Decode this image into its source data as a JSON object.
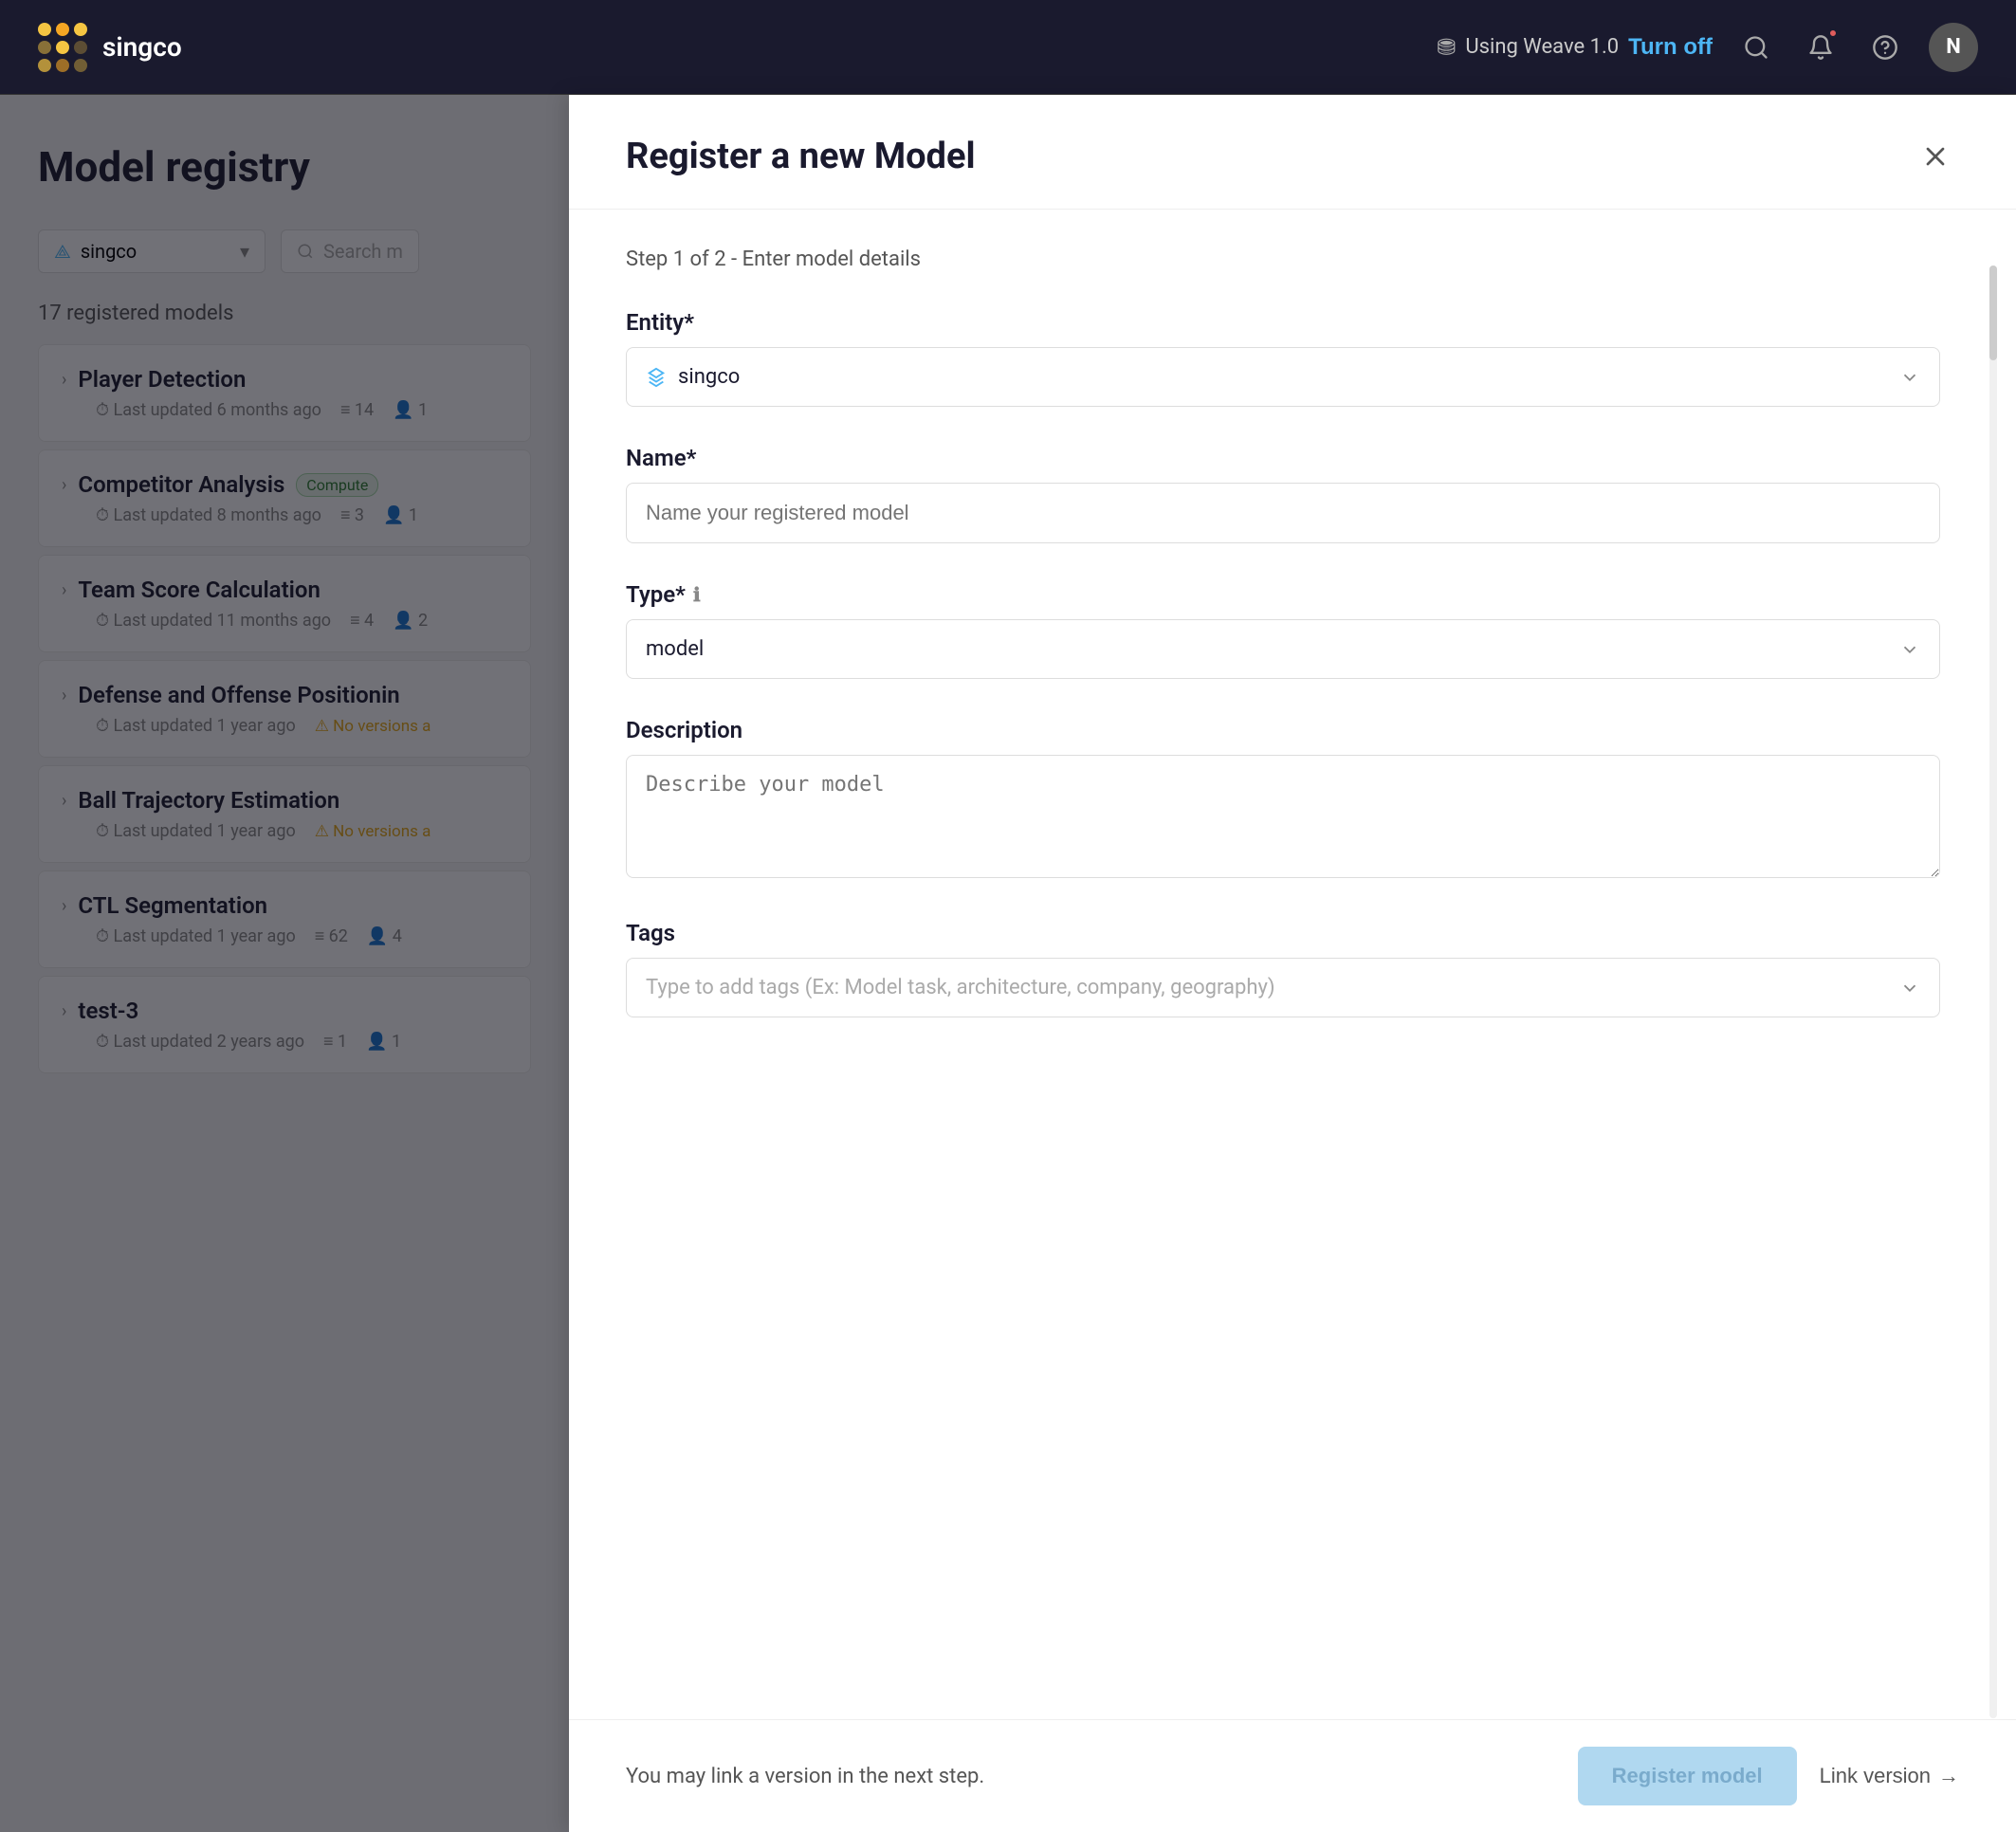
{
  "app": {
    "name": "singco",
    "user_initial": "N"
  },
  "topnav": {
    "weave_label": "Using Weave 1.0",
    "turnoff_label": "Turn off",
    "search_tooltip": "Search",
    "notifications_tooltip": "Notifications",
    "help_tooltip": "Help"
  },
  "sidebar": {
    "page_title": "Model registry",
    "entity_name": "singco",
    "search_placeholder": "Search m",
    "registered_count": "17 registered models",
    "models": [
      {
        "name": "Player Detection",
        "meta": "Last updated 6 months ago",
        "versions": "14",
        "users": "1",
        "badge": null,
        "no_versions": false
      },
      {
        "name": "Competitor Analysis",
        "meta": "Last updated 8 months ago",
        "versions": "3",
        "users": "1",
        "badge": "Compute",
        "no_versions": false
      },
      {
        "name": "Team Score Calculation",
        "meta": "Last updated 11 months ago",
        "versions": "4",
        "users": "2",
        "badge": null,
        "no_versions": false
      },
      {
        "name": "Defense and Offense Positionin",
        "meta": "Last updated 1 year ago",
        "versions": null,
        "users": null,
        "badge": null,
        "no_versions": true,
        "no_versions_text": "No versions a"
      },
      {
        "name": "Ball Trajectory Estimation",
        "meta": "Last updated 1 year ago",
        "versions": null,
        "users": null,
        "badge": null,
        "no_versions": true,
        "no_versions_text": "No versions a"
      },
      {
        "name": "CTL Segmentation",
        "meta": "Last updated 1 year ago",
        "versions": "62",
        "users": "4",
        "badge": null,
        "no_versions": false
      },
      {
        "name": "test-3",
        "meta": "Last updated 2 years ago",
        "versions": "1",
        "users": "1",
        "badge": null,
        "no_versions": false
      }
    ]
  },
  "modal": {
    "title": "Register a new Model",
    "step_label": "Step 1 of 2 - Enter model details",
    "entity_label": "Entity*",
    "entity_value": "singco",
    "name_label": "Name*",
    "name_placeholder": "Name your registered model",
    "type_label": "Type*",
    "type_value": "model",
    "description_label": "Description",
    "description_placeholder": "Describe your model",
    "tags_label": "Tags",
    "tags_placeholder": "Type to add tags (Ex: Model task, architecture, company, geography)",
    "footer_hint": "You may link a version in the next step.",
    "register_btn": "Register model",
    "link_btn": "Link version"
  }
}
